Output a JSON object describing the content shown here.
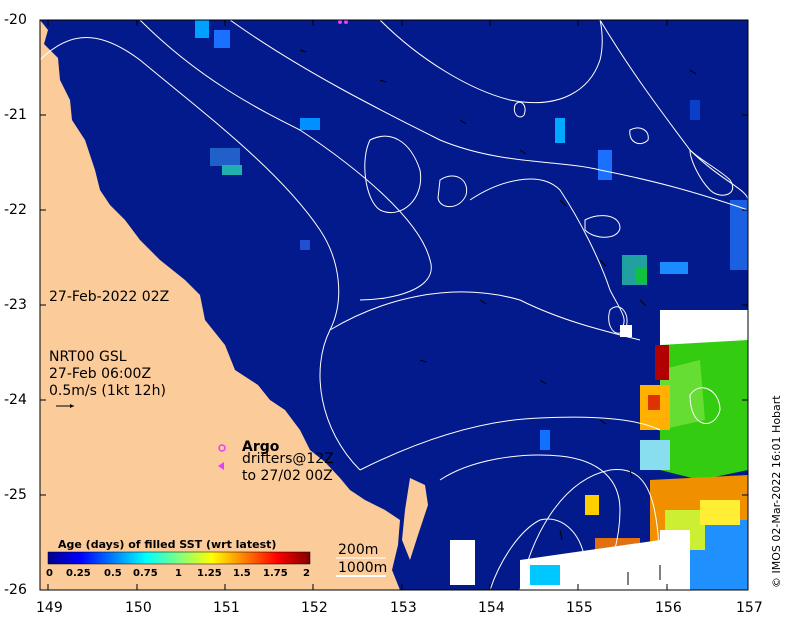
{
  "map": {
    "y_ticks": [
      "-20",
      "-21",
      "-22",
      "-23",
      "-24",
      "-25",
      "-26"
    ],
    "x_ticks": [
      "149",
      "150",
      "151",
      "152",
      "153",
      "154",
      "155",
      "156",
      "157"
    ],
    "date_label": "27-Feb-2022 02Z",
    "model_label": "NRT00 GSL",
    "model_time": "27-Feb 06:00Z",
    "speed_scale": "0.5m/s (1kt 12h)",
    "argo_label": "Argo",
    "drifters_label": "drifters@12Z",
    "drifters_to": "to 27/02 00Z",
    "contour_200": "200m",
    "contour_1000": "1000m",
    "credit": "© IMOS 02-Mar-2022 16:01 Hobart"
  },
  "colorbar": {
    "title": "Age (days) of filled SST (wrt latest)",
    "ticks": [
      "0",
      "0.25",
      "0.5",
      "0.75",
      "1",
      "1.25",
      "1.5",
      "1.75",
      "2"
    ]
  },
  "colors": {
    "ocean": "#031a8c",
    "land": "#fccb9a",
    "contour": "#ffffff",
    "marker": "#e040ff"
  },
  "chart_data": {
    "type": "heatmap",
    "lon_range": [
      149,
      157
    ],
    "lat_range": [
      -26,
      -20
    ],
    "colorbar_range": [
      0,
      2
    ]
  }
}
